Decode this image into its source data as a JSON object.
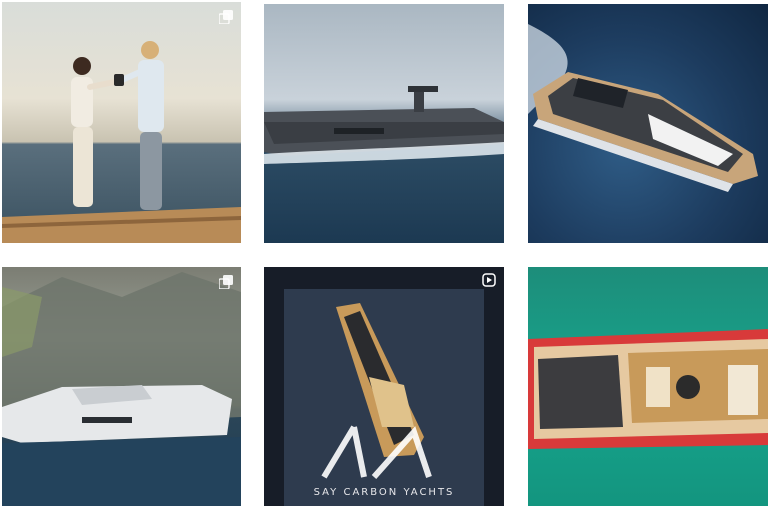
{
  "gallery": {
    "posts": [
      {
        "subject": "couple-toasting-on-yacht-bow",
        "badge": "multi-image-icon"
      },
      {
        "subject": "dark-grey-yacht-cruising"
      },
      {
        "subject": "carbon-yacht-aerial-wake"
      },
      {
        "subject": "white-yacht-by-rocky-coast",
        "badge": "multi-image-icon"
      },
      {
        "subject": "wooden-deck-yacht-aerial",
        "badge": "reel-icon",
        "caption": "SAY CARBON YACHTS"
      },
      {
        "subject": "red-yacht-topdown-turquoise"
      }
    ]
  },
  "colors": {
    "sea_blue": "#1c3952",
    "turquoise": "#17a58d",
    "yacht_red": "#d83a3a",
    "teak": "#c89a5a"
  }
}
